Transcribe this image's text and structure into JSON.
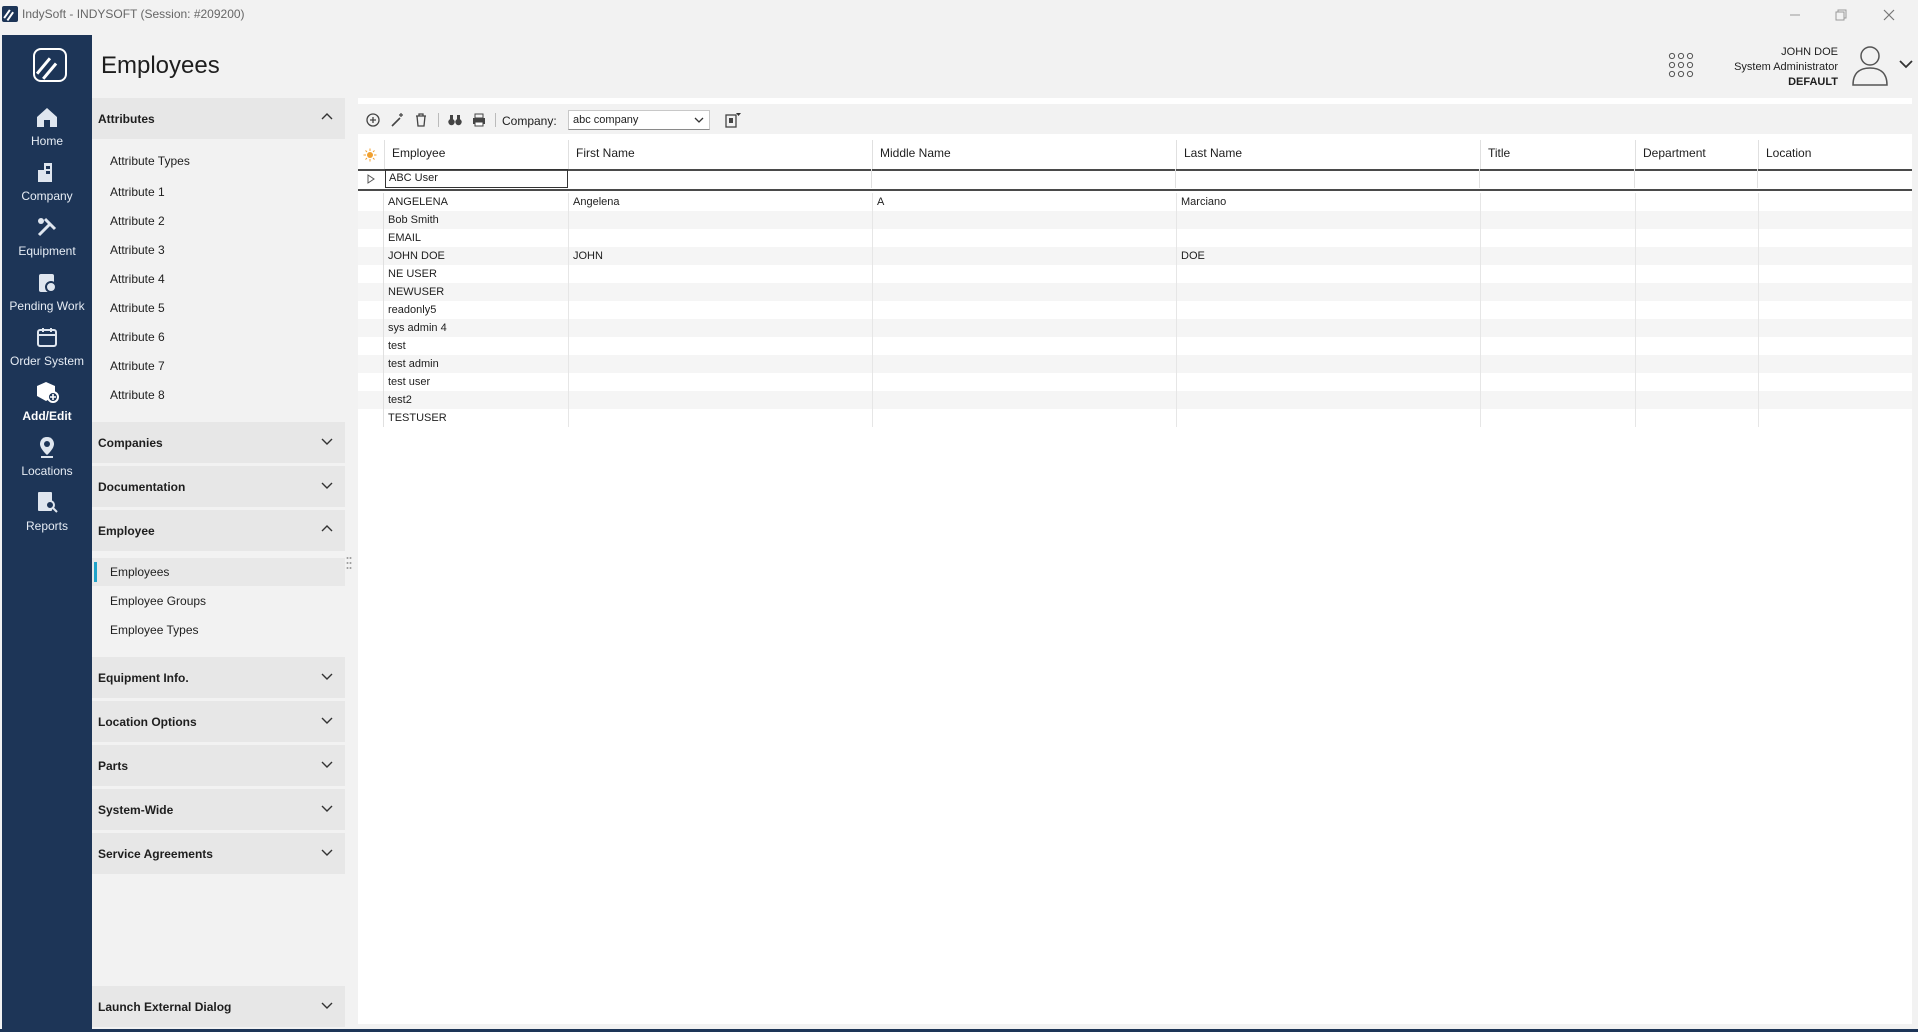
{
  "window": {
    "title": "IndySoft - INDYSOFT (Session: #209200)"
  },
  "rail": {
    "items": [
      {
        "label": "Home",
        "icon": "home-icon"
      },
      {
        "label": "Company",
        "icon": "company-icon"
      },
      {
        "label": "Equipment",
        "icon": "equipment-icon"
      },
      {
        "label": "Pending Work",
        "icon": "pending-work-icon"
      },
      {
        "label": "Order System",
        "icon": "order-system-icon"
      },
      {
        "label": "Add/Edit",
        "icon": "add-edit-icon",
        "active": true
      },
      {
        "label": "Locations",
        "icon": "locations-icon"
      },
      {
        "label": "Reports",
        "icon": "reports-icon"
      }
    ]
  },
  "header": {
    "title": "Employees",
    "user_name": "JOHN DOE",
    "user_role": "System Administrator",
    "user_profile": "DEFAULT"
  },
  "panel": {
    "attributes": {
      "label": "Attributes",
      "items": [
        "Attribute Types",
        "Attribute 1",
        "Attribute 2",
        "Attribute 3",
        "Attribute 4",
        "Attribute 5",
        "Attribute 6",
        "Attribute 7",
        "Attribute 8"
      ]
    },
    "companies": {
      "label": "Companies"
    },
    "documentation": {
      "label": "Documentation"
    },
    "employee": {
      "label": "Employee",
      "items": [
        "Employees",
        "Employee Groups",
        "Employee Types"
      ]
    },
    "equipment_info": {
      "label": "Equipment Info."
    },
    "location_options": {
      "label": "Location Options"
    },
    "parts": {
      "label": "Parts"
    },
    "system_wide": {
      "label": "System-Wide"
    },
    "service_agreements": {
      "label": "Service Agreements"
    },
    "launch_external": {
      "label": "Launch External Dialog"
    }
  },
  "toolbar": {
    "company_label": "Company:",
    "company_value": "abc company"
  },
  "grid": {
    "columns": [
      "Employee",
      "First Name",
      "Middle Name",
      "Last Name",
      "Title",
      "Department",
      "Location"
    ],
    "group_row": "ABC User",
    "rows": [
      [
        "ANGELENA",
        "Angelena",
        "A",
        "Marciano",
        "",
        "",
        ""
      ],
      [
        "Bob Smith",
        "",
        "",
        "",
        "",
        "",
        ""
      ],
      [
        "EMAIL",
        "",
        "",
        "",
        "",
        "",
        ""
      ],
      [
        "JOHN DOE",
        "JOHN",
        "",
        "DOE",
        "",
        "",
        ""
      ],
      [
        "NE USER",
        "",
        "",
        "",
        "",
        "",
        ""
      ],
      [
        "NEWUSER",
        "",
        "",
        "",
        "",
        "",
        ""
      ],
      [
        "readonly5",
        "",
        "",
        "",
        "",
        "",
        ""
      ],
      [
        "sys admin 4",
        "",
        "",
        "",
        "",
        "",
        ""
      ],
      [
        "test",
        "",
        "",
        "",
        "",
        "",
        ""
      ],
      [
        "test admin",
        "",
        "",
        "",
        "",
        "",
        ""
      ],
      [
        "test user",
        "",
        "",
        "",
        "",
        "",
        ""
      ],
      [
        "test2",
        "",
        "",
        "",
        "",
        "",
        ""
      ],
      [
        "TESTUSER",
        "",
        "",
        "",
        "",
        "",
        ""
      ]
    ]
  },
  "colors": {
    "rail_bg": "#1d3557",
    "accent": "#1fa2c9"
  }
}
